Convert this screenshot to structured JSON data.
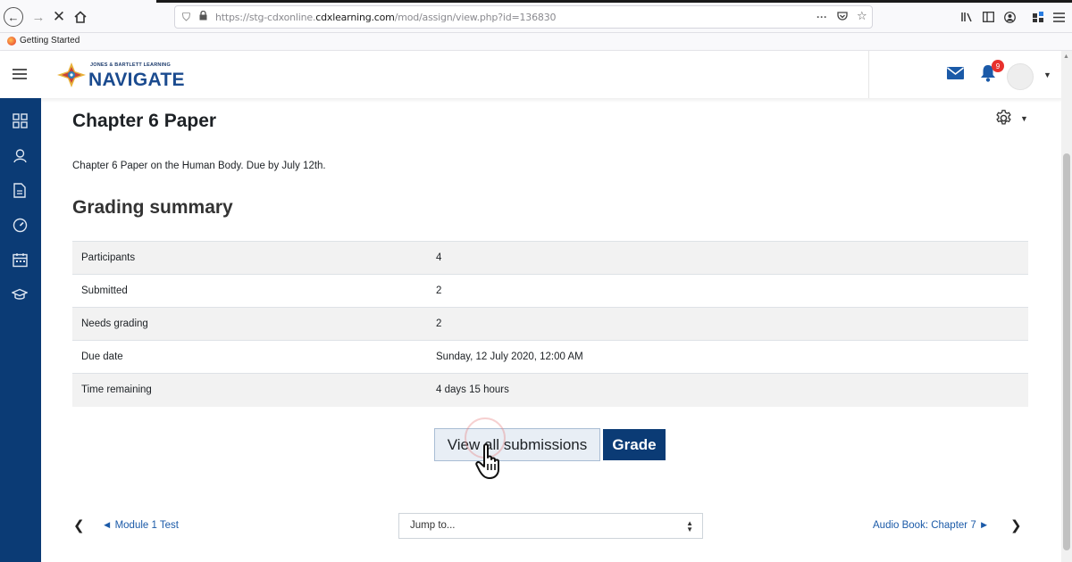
{
  "browser": {
    "url_prefix": "https://stg-cdxonline.",
    "url_domain": "cdxlearning.com",
    "url_suffix": "/mod/assign/view.php?id=136830",
    "url_menu": "···",
    "bookmark": "Getting Started"
  },
  "navbar": {
    "logo_small": "JONES & BARTLETT LEARNING",
    "logo_main": "NAVIGATE",
    "notification_count": "9"
  },
  "page": {
    "title": "Chapter 6 Paper",
    "intro": "Chapter 6 Paper on the Human Body. Due by July 12th.",
    "section_title": "Grading summary"
  },
  "grading_summary": [
    {
      "label": "Participants",
      "value": "4"
    },
    {
      "label": "Submitted",
      "value": "2"
    },
    {
      "label": "Needs grading",
      "value": "2"
    },
    {
      "label": "Due date",
      "value": "Sunday, 12 July 2020, 12:00 AM"
    },
    {
      "label": "Time remaining",
      "value": "4 days 15 hours"
    }
  ],
  "actions": {
    "view_all": "View all submissions",
    "grade": "Grade"
  },
  "footer_nav": {
    "prev": "◄ Module 1 Test",
    "jump": "Jump to...",
    "next": "Audio Book: Chapter 7 ►"
  },
  "colors": {
    "brand_navy": "#0b3b75",
    "link_blue": "#1b5aa8",
    "badge_red": "#e8312d"
  }
}
